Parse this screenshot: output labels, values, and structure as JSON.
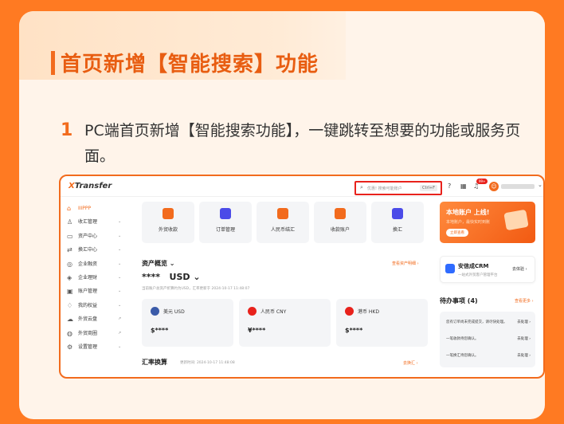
{
  "header": {
    "title": "首页新增【智能搜索】功能"
  },
  "step": {
    "number": "1",
    "text": "PC端首页新增【智能搜索功能】，一键跳转至想要的功能或服务页面。"
  },
  "app": {
    "logo_x": "X",
    "logo_rest": "Transfer",
    "search": {
      "placeholder": "优惠! 搜索可能账户",
      "shortcut": "Ctrl+F"
    },
    "notification_badge": "99+",
    "sidebar": [
      {
        "label": "IIIPPP",
        "icon": "home-icon",
        "active": true,
        "arrow": ""
      },
      {
        "label": "收汇管理",
        "icon": "user-icon",
        "arrow": "⌄"
      },
      {
        "label": "资产中心",
        "icon": "wallet-icon",
        "arrow": "⌄"
      },
      {
        "label": "换汇中心",
        "icon": "exchange-icon",
        "arrow": "⌄"
      },
      {
        "label": "企业融资",
        "icon": "finance-icon",
        "arrow": "⌄"
      },
      {
        "label": "企业理财",
        "icon": "shield-icon",
        "arrow": "⌄"
      },
      {
        "label": "账户管理",
        "icon": "account-icon",
        "arrow": "⌄"
      },
      {
        "label": "我的权益",
        "icon": "gift-icon",
        "arrow": "⌄"
      },
      {
        "label": "外贸云盘",
        "icon": "cloud-icon",
        "arrow": "↗"
      },
      {
        "label": "外贸商圈",
        "icon": "globe-icon",
        "arrow": "↗"
      },
      {
        "label": "设置管理",
        "icon": "gear-icon",
        "arrow": "⌄"
      }
    ],
    "quick_actions": [
      {
        "label": "外贸收款",
        "color": "#F26B1D"
      },
      {
        "label": "订单管理",
        "color": "#4B4BE8"
      },
      {
        "label": "人民币结汇",
        "color": "#F26B1D"
      },
      {
        "label": "收款账户",
        "color": "#F26B1D"
      },
      {
        "label": "换汇",
        "color": "#4B4BE8"
      }
    ],
    "assets": {
      "title": "资产概览",
      "link": "查看资产明细",
      "amount": "****",
      "currency": "USD",
      "note": "当前账户总资产折算约为USD，汇率更新于 2024-10-17 11:48:07",
      "currencies": [
        {
          "name": "美元 USD",
          "value": "$****",
          "color": "#3B5BA9"
        },
        {
          "name": "人民币 CNY",
          "value": "¥****",
          "color": "#E8221C"
        },
        {
          "name": "港币 HKD",
          "value": "$****",
          "color": "#E8221C"
        }
      ]
    },
    "fx": {
      "title": "汇率换算",
      "time": "更新时间: 2024-10-17 11:48:08",
      "link": "去换汇"
    },
    "promo": {
      "title": "本地账户 上线!",
      "subtitle": "本地账户，最快实时到账",
      "button": "立即查看"
    },
    "crm": {
      "title": "安信成CRM",
      "subtitle": "一站式外贸客户管理平台",
      "link": "去体验"
    },
    "todo": {
      "title": "待办事项 (4)",
      "link": "查看更多",
      "items": [
        {
          "text": "您有订单尚未完成提交，请尽快处理。",
          "action": "去处理"
        },
        {
          "text": "一笔收款待您确认。",
          "action": "去处理"
        },
        {
          "text": "一笔换汇待您确认。",
          "action": "去处理"
        }
      ]
    }
  }
}
